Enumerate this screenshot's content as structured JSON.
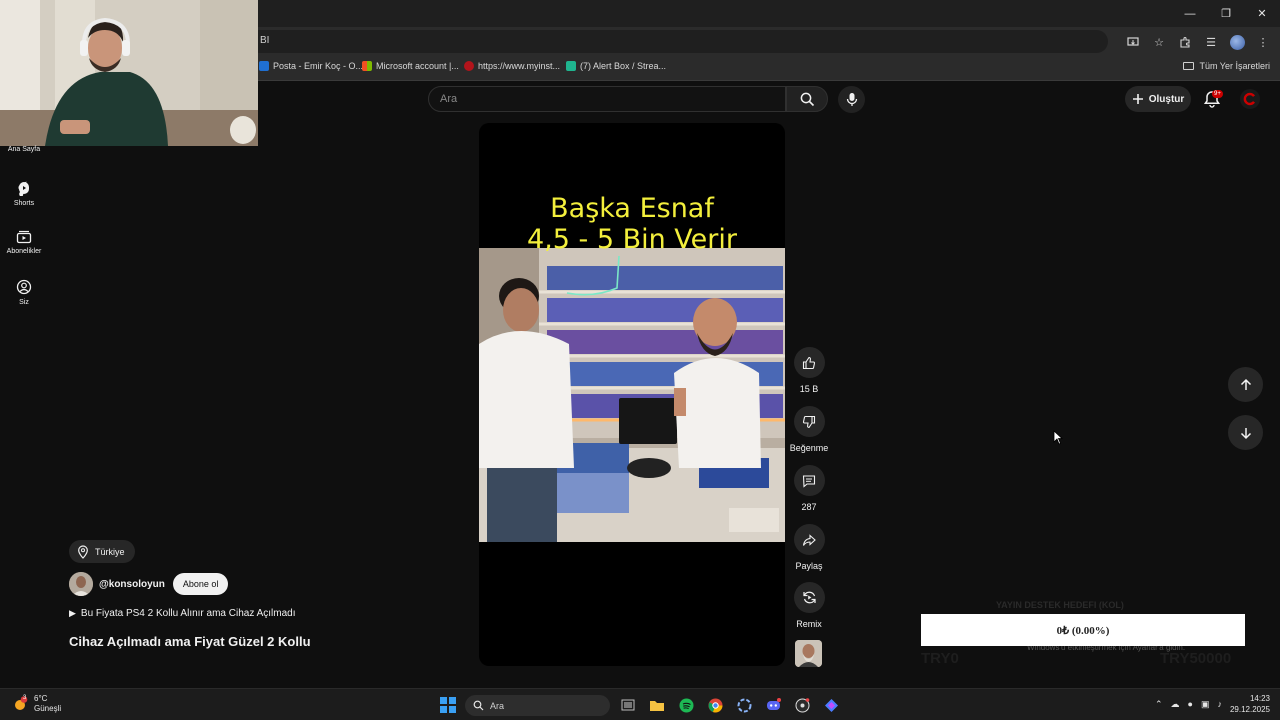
{
  "browser": {
    "url_fragment": "BI",
    "bookmarks": [
      {
        "label": "Posta - Emir Koç - O...",
        "color": "#1f6fd1"
      },
      {
        "label": "Microsoft account |...",
        "color": "#e8532b"
      },
      {
        "label": "https://www.myinst...",
        "color": "#b3141b"
      },
      {
        "label": "(7) Alert Box / Strea...",
        "color": "#1fb58f"
      }
    ],
    "all_bookmarks_label": "Tüm Yer İşaretleri"
  },
  "youtube": {
    "nav": [
      {
        "label": "Ana Sayfa",
        "icon": "home-icon"
      },
      {
        "label": "Shorts",
        "icon": "shorts-icon"
      },
      {
        "label": "Abonelikler",
        "icon": "subscriptions-icon"
      },
      {
        "label": "Siz",
        "icon": "you-icon"
      }
    ],
    "search_placeholder": "Ara",
    "create_label": "Oluştur",
    "notification_badge": "9+",
    "short": {
      "overlay_title_line1": "Başka Esnaf",
      "overlay_title_line2": "4,5 - 5 Bin Verir",
      "likes": "15 B",
      "dislike_label": "Beğenme",
      "comments": "287",
      "share_label": "Paylaş",
      "remix_label": "Remix",
      "location": "Türkiye",
      "channel": "@konsoloyun",
      "subscribe_label": "Abone ol",
      "playlist": "Bu Fiyata PS4 2 Kollu Alınır ama Cihaz Açılmadı",
      "title": "Cihaz Açılmadı ama Fiyat Güzel 2 Kollu"
    }
  },
  "donation_widget": {
    "goal_text": "0₺ (0.00%)",
    "min_label": "TRY0",
    "max_label": "TRY50000",
    "header_faint": "YAYIN DESTEK HEDEFI (KOL)",
    "windows_notice": "Windows'u etkinleştirmek için Ayarlar'a gidin."
  },
  "taskbar": {
    "temperature": "6°C",
    "weather": "Güneşli",
    "weather_badge": "3",
    "search_placeholder": "Ara",
    "time": "14:23",
    "date": "29.12.2025"
  },
  "colors": {
    "accent_red": "#cc0000",
    "title_yellow": "#f3ef3c"
  }
}
